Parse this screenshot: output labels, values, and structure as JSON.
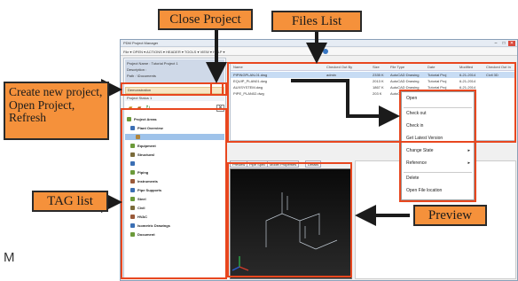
{
  "window": {
    "title": "PDM Project Manager",
    "address": "File ▾  OPEN ▾  ACTIONS ▾  HEADER ▾  TOOLS ▾  VIEW ▾  HELP ▾"
  },
  "project_panel": {
    "info_lines": [
      "Project Name : Tutorial Project 1",
      "Description :",
      "Path : \\Documents"
    ],
    "description_label": "Demonstration",
    "status_label": "Project Status 1",
    "toolbar_icons": [
      "open-folder-icon",
      "close-folder-icon",
      "refresh-icon"
    ],
    "close_glyph": "✕"
  },
  "tree": {
    "items": [
      {
        "label": "Project Areas",
        "color": "#6b9a3a"
      },
      {
        "label": "Plant Overview",
        "color": "#3b6fb4"
      },
      {
        "label": "",
        "color": "#b0843a"
      },
      {
        "label": "Equipment",
        "color": "#6b9a3a"
      },
      {
        "label": "Structural",
        "color": "#7a6b3a"
      },
      {
        "label": "",
        "color": "#3b6fb4"
      },
      {
        "label": "Piping",
        "color": "#6b9a3a"
      },
      {
        "label": "Instruments",
        "color": "#9a5a3a"
      },
      {
        "label": "Pipe Supports",
        "color": "#3b6fb4"
      },
      {
        "label": "Steel",
        "color": "#6b9a3a"
      },
      {
        "label": "Civil",
        "color": "#7a6b3a"
      },
      {
        "label": "HVAC",
        "color": "#9a5a3a"
      },
      {
        "label": "Isometric Drawings",
        "color": "#3b6fb4"
      },
      {
        "label": "Document",
        "color": "#6b9a3a"
      }
    ]
  },
  "files": {
    "headers": [
      "Name",
      "Checked Out By",
      "Size",
      "File Type",
      "Date",
      "Modified",
      "Checked Out In"
    ],
    "rows": [
      [
        "PIPINGPLAN-01.dwg",
        "admin",
        "2335 K",
        "AutoCAD Drawing",
        "Tutorial Proj",
        "6-21-2014",
        "Civil 3D"
      ],
      [
        "EQUIP_PLAN01.dwg",
        "",
        "2013 K",
        "AutoCAD Drawing",
        "Tutorial Proj",
        "6-21-2014",
        ""
      ],
      [
        "AUXSYSTEM.dwg",
        "",
        "1867 K",
        "AutoCAD Drawing",
        "Tutorial Proj",
        "6-21-2014",
        ""
      ],
      [
        "PIPE_PLAN02.dwg",
        "",
        "203 K",
        "AutoCAD Drawing",
        "Tutorial Proj",
        "6-21-2014",
        ""
      ]
    ]
  },
  "preview_tabs": [
    "Preview",
    "Pipe Spec",
    "Model Properties",
    "Details"
  ],
  "context_menu": {
    "items": [
      {
        "label": "Open",
        "submenu": false
      },
      {
        "label": "Check out",
        "submenu": false
      },
      {
        "label": "Check in",
        "submenu": false
      },
      {
        "label": "Get Latest Version",
        "submenu": false
      },
      {
        "label": "Change State",
        "submenu": true
      },
      {
        "label": "Reference",
        "submenu": true
      },
      {
        "label": "Delete",
        "submenu": false
      },
      {
        "label": "Open File location",
        "submenu": false
      }
    ]
  },
  "callouts": {
    "close_project": "Close Project",
    "files_list": "Files List",
    "create_new": "Create new project, Open Project, Refresh",
    "tag_list": "TAG list",
    "preview": "Preview"
  },
  "stray_text": "M",
  "colors": {
    "callout": "#f5913b",
    "highlight": "#e8471f",
    "arrow": "#1b1b1b"
  }
}
